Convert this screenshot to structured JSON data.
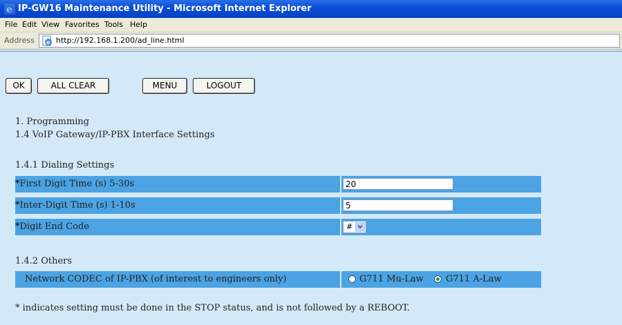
{
  "window": {
    "title": "IP-GW16 Maintenance Utility - Microsoft Internet Explorer"
  },
  "menubar": {
    "items": [
      "File",
      "Edit",
      "View",
      "Favorites",
      "Tools",
      "Help"
    ]
  },
  "address_bar": {
    "label": "Address",
    "url": "http://192.168.1.200/ad_line.html"
  },
  "toolbar": {
    "ok_label": "OK",
    "all_clear_label": "ALL CLEAR",
    "menu_label": "MENU",
    "logout_label": "LOGOUT"
  },
  "headings": {
    "section": "1. Programming",
    "subsection": "1.4 VoIP Gateway/IP-PBX Interface Settings"
  },
  "dialing": {
    "title": "1.4.1 Dialing Settings",
    "first_digit": {
      "marker": "*",
      "label": "First Digit Time (s) 5-30s",
      "value": "20"
    },
    "inter_digit": {
      "marker": "*",
      "label": "Inter-Digit Time (s) 1-10s",
      "value": "5"
    },
    "end_code": {
      "marker": "*",
      "label": "Digit End Code",
      "value": "#"
    }
  },
  "others": {
    "title": "1.4.2 Others",
    "codec": {
      "label": "Network CODEC of IP-PBX (of interest to engineers only)",
      "options": [
        {
          "label": "G711 Mu-Law",
          "selected": false
        },
        {
          "label": "G711 A-Law",
          "selected": true
        }
      ]
    }
  },
  "footnote": "* indicates setting must be done in the STOP status, and is not followed by a REBOOT.",
  "colors": {
    "background": "#d4e9f7",
    "row_blue": "#4ba3e3",
    "titlebar": "#0a4fd6"
  }
}
